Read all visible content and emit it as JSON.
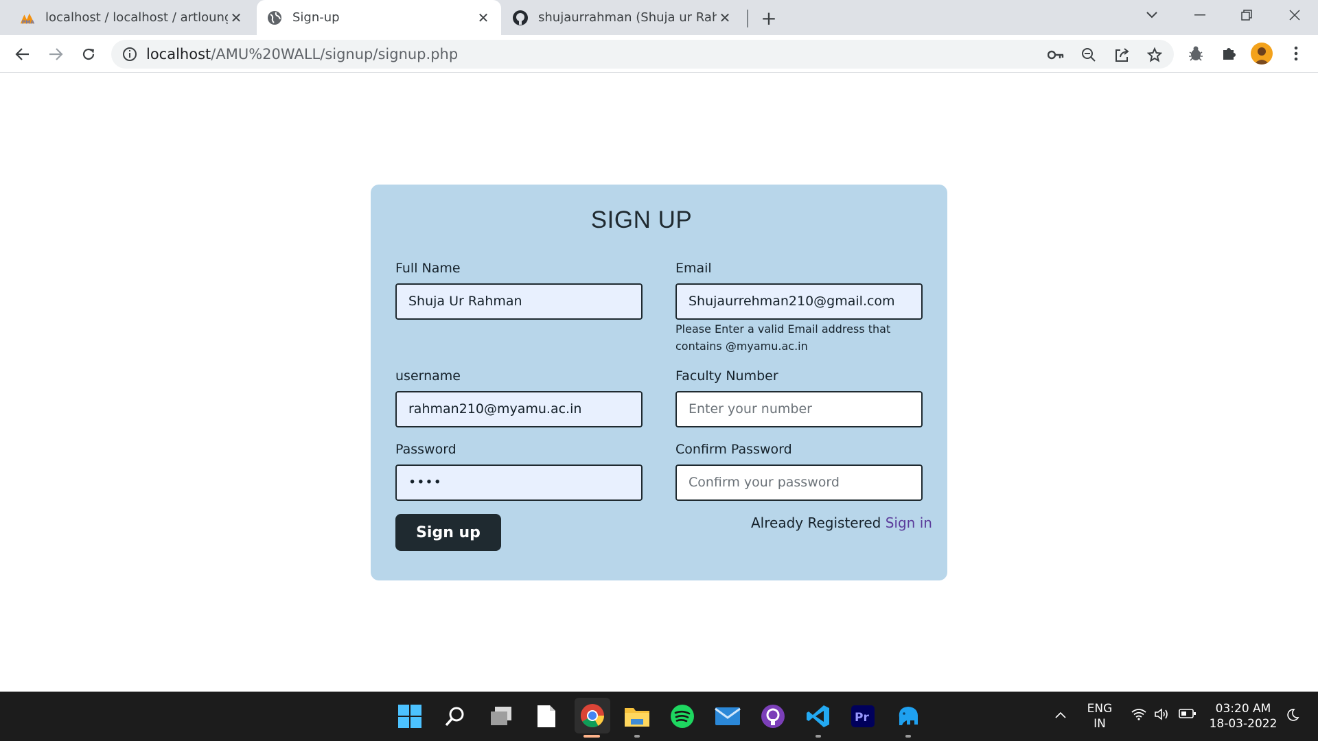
{
  "browser": {
    "tabs": [
      {
        "title": "localhost / localhost / artlounge / ",
        "icon": "phpmyadmin-icon",
        "active": false
      },
      {
        "title": "Sign-up",
        "icon": "globe-icon",
        "active": true
      },
      {
        "title": "shujaurrahman (Shuja ur Rahman)",
        "icon": "github-icon",
        "active": false
      }
    ],
    "url_main": "localhost",
    "url_path": "/AMU%20WALL/signup/signup.php"
  },
  "form": {
    "title": "SIGN UP",
    "full_name": {
      "label": "Full Name",
      "value": "Shuja Ur Rahman"
    },
    "email": {
      "label": "Email",
      "value": "Shujaurrehman210@gmail.com",
      "help": "Please Enter a valid Email address that contains @myamu.ac.in"
    },
    "username": {
      "label": "username",
      "value": "rahman210@myamu.ac.in"
    },
    "faculty": {
      "label": "Faculty Number",
      "placeholder": "Enter your number"
    },
    "password": {
      "label": "Password",
      "value": "••••"
    },
    "confirm": {
      "label": "Confirm Password",
      "placeholder": "Confirm your password"
    },
    "submit": "Sign up",
    "already_text": "Already Registered ",
    "signin_link": "Sign in"
  },
  "taskbar": {
    "lang_line1": "ENG",
    "lang_line2": "IN",
    "time": "03:20 AM",
    "date": "18-03-2022"
  },
  "colors": {
    "card_bg": "#b8d6ea",
    "button_bg": "#1f2a30",
    "link": "#5b3c9b"
  }
}
